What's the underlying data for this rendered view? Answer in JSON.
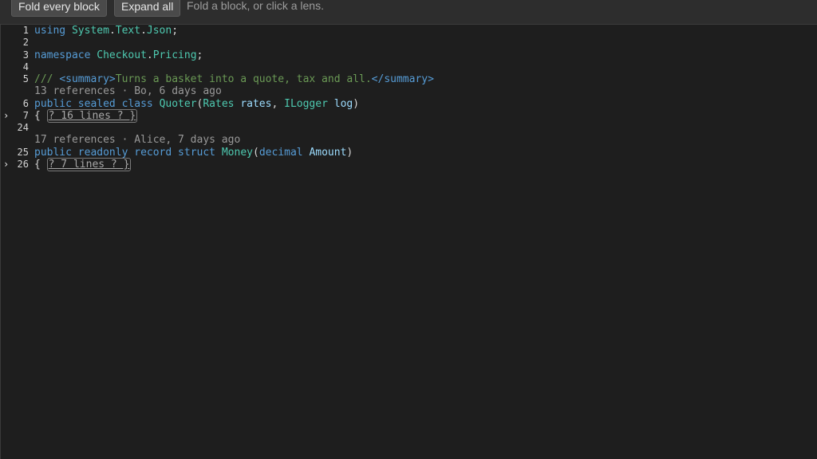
{
  "toolbar": {
    "fold_all_label": "Fold every block",
    "expand_all_label": "Expand all",
    "hint": "Fold a block, or click a lens."
  },
  "editor": {
    "chevron": "›",
    "line1": {
      "num": "1",
      "kw": "using",
      "ns1": "System",
      "dot1": ".",
      "ns2": "Text",
      "dot2": ".",
      "ns3": "Json",
      "end": ";"
    },
    "line2": {
      "num": "2"
    },
    "line3": {
      "num": "3",
      "kw": "namespace",
      "ns1": "Checkout",
      "dot": ".",
      "ns2": "Pricing",
      "end": ";"
    },
    "line4": {
      "num": "4"
    },
    "line5": {
      "num": "5",
      "slashes": "/// ",
      "open_tag": "<summary>",
      "text": "Turns a basket into a quote, tax and all.",
      "close_tag": "</summary>"
    },
    "lens1": {
      "refs": "13 references",
      "sep": " · ",
      "author": "Bo, 6 days ago"
    },
    "line6": {
      "num": "6",
      "kw1": "public",
      "kw2": "sealed",
      "kw3": "class",
      "type": "Quoter",
      "open": "(",
      "ptype1": "Rates",
      "pname1": "rates",
      "comma": ", ",
      "ptype2": "ILogger",
      "pname2": "log",
      "close": ")"
    },
    "line7": {
      "num": "7",
      "brace": "{ ",
      "folded": "? 16 lines ? }"
    },
    "line24": {
      "num": "24"
    },
    "lens2": {
      "refs": "17 references",
      "sep": " · ",
      "author": "Alice, 7 days ago"
    },
    "line25": {
      "num": "25",
      "kw1": "public",
      "kw2": "readonly",
      "kw3": "record",
      "kw4": "struct",
      "type": "Money",
      "open": "(",
      "ptype": "decimal",
      "pname": "Amount",
      "close": ")"
    },
    "line26": {
      "num": "26",
      "brace": "{ ",
      "folded": "? 7 lines ? }"
    }
  },
  "colors": {
    "background": "#1e1e1e",
    "keyword": "#569cd6",
    "type": "#4ec9b0",
    "parameter": "#9cdcfe",
    "comment": "#6a9955",
    "lens": "#999999"
  }
}
